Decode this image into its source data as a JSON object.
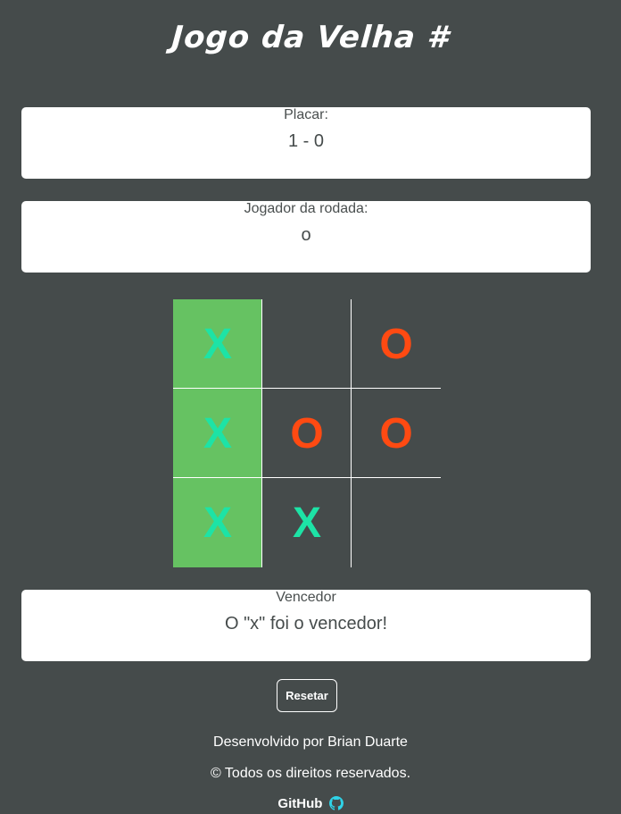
{
  "header": {
    "title": "Jogo da Velha #"
  },
  "score": {
    "label": "Placar:",
    "value": "1 - 0"
  },
  "turn": {
    "label": "Jogador da rodada:",
    "value": "o"
  },
  "board": {
    "cells": [
      {
        "mark": "x",
        "winning": true
      },
      {
        "mark": "",
        "winning": false
      },
      {
        "mark": "o",
        "winning": false
      },
      {
        "mark": "x",
        "winning": true
      },
      {
        "mark": "o",
        "winning": false
      },
      {
        "mark": "o",
        "winning": false
      },
      {
        "mark": "x",
        "winning": true
      },
      {
        "mark": "x",
        "winning": false
      },
      {
        "mark": "",
        "winning": false
      }
    ],
    "colors": {
      "x": "#1de3a6",
      "o": "#ff4a12",
      "win": "#66c262"
    }
  },
  "winner": {
    "label": "Vencedor",
    "value": "O \"x\" foi o vencedor!"
  },
  "controls": {
    "reset_label": "Resetar"
  },
  "footer": {
    "developer": "Desenvolvido por Brian Duarte",
    "rights": "© Todos os direitos reservados.",
    "github_label": "GitHub",
    "github_icon": "github-icon"
  }
}
